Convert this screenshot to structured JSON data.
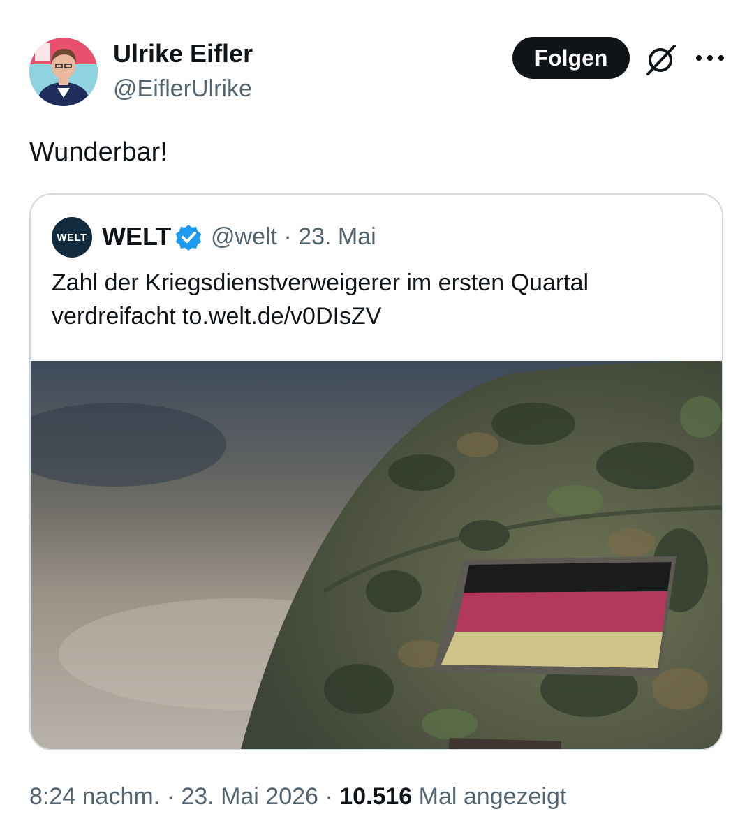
{
  "author": {
    "name": "Ulrike Eifler",
    "handle": "@EiflerUlrike"
  },
  "actions": {
    "follow_label": "Folgen",
    "grok_icon": "grok-icon",
    "more_icon": "more-options-icon"
  },
  "tweet": {
    "text": "Wunderbar!",
    "time": "8:24 nachm.",
    "separator1": "·",
    "date": "23. Mai 2026",
    "separator2": "·",
    "views_count": "10.516",
    "views_label": "Mal angezeigt"
  },
  "quote": {
    "avatar_text": "WELT",
    "name": "WELT",
    "verified_icon": "verified-badge-icon",
    "handle": "@welt",
    "separator": "·",
    "date": "23. Mai",
    "text": "Zahl der Kriegsdienstverweigerer im ersten Quartal verdreifacht to.welt.de/v0DIsZV"
  },
  "colors": {
    "text_primary": "#0f1419",
    "text_secondary": "#536471",
    "border": "#cfd9de",
    "verified_blue": "#1d9bf0",
    "button_dark": "#0f1419"
  }
}
